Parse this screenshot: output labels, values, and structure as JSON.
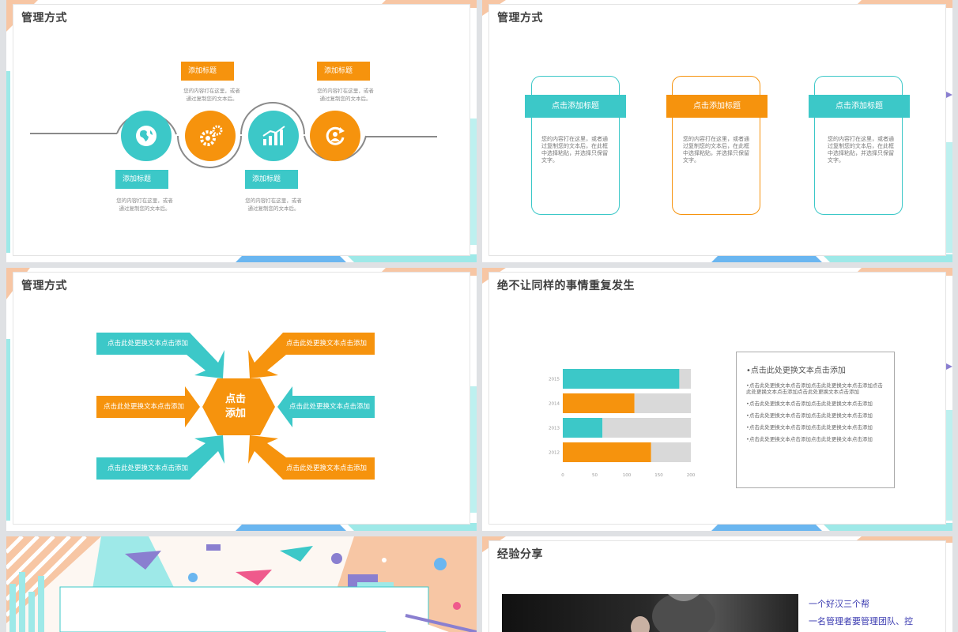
{
  "slides": {
    "s1": {
      "title": "管理方式",
      "tags": [
        {
          "label": "添加标题",
          "text_line1": "您的内容打在这里，或者",
          "text_line2": "通过复制您的文本后。"
        },
        {
          "label": "添加标题",
          "text_line1": "您的内容打在这里，或者",
          "text_line2": "通过复制您的文本后。"
        },
        {
          "label": "添加标题",
          "text_line1": "您的内容打在这里，或者",
          "text_line2": "通过复制您的文本后。"
        },
        {
          "label": "添加标题",
          "text_line1": "您的内容打在这里，或者",
          "text_line2": "通过复制您的文本后。"
        }
      ],
      "icons": [
        "globe-icon",
        "gears-icon",
        "bar-chart-icon",
        "refresh-person-icon"
      ]
    },
    "s2": {
      "title": "管理方式",
      "cards": [
        {
          "head": "点击添加标题",
          "text": "您的内容打在这里，或者通过复制您的文本后，在此框中选择粘贴，并选择只保留文字。",
          "color": "#3cc8c8"
        },
        {
          "head": "点击添加标题",
          "text": "您的内容打在这里，或者通过复制您的文本后，在此框中选择粘贴，并选择只保留文字。",
          "color": "#f6930d"
        },
        {
          "head": "点击添加标题",
          "text": "您的内容打在这里，或者通过复制您的文本后，在此框中选择粘贴，并选择只保留文字。",
          "color": "#3cc8c8"
        }
      ]
    },
    "s3": {
      "title": "管理方式",
      "center_line1": "点击",
      "center_line2": "添加",
      "arrows": [
        {
          "label": "点击此处更换文本点击添加",
          "color": "#3cc8c8"
        },
        {
          "label": "点击此处更换文本点击添加",
          "color": "#f6930d"
        },
        {
          "label": "点击此处更换文本点击添加",
          "color": "#f6930d"
        },
        {
          "label": "点击此处更换文本点击添加",
          "color": "#3cc8c8"
        },
        {
          "label": "点击此处更换文本点击添加",
          "color": "#3cc8c8"
        },
        {
          "label": "点击此处更换文本点击添加",
          "color": "#f6930d"
        }
      ]
    },
    "s4": {
      "title": "绝不让同样的事情重复发生",
      "panel_heading": "•点击此处更换文本点击添加",
      "bullets": [
        "•点击此处更换文本点击添加点击此处更换文本点击添加点击此处更换文本点击添加点击此处更换文本点击添加",
        "•点击此处更换文本点击添加点击此处更换文本点击添加",
        "•点击此处更换文本点击添加点击此处更换文本点击添加",
        "•点击此处更换文本点击添加点击此处更换文本点击添加",
        "•点击此处更换文本点击添加点击此处更换文本点击添加"
      ]
    },
    "s6": {
      "title": "经验分享",
      "line1": "一个好汉三个帮",
      "line2": "一名管理者要管理团队、控"
    }
  },
  "chart_data": {
    "type": "bar",
    "orientation": "horizontal",
    "stacked": true,
    "categories": [
      "2015",
      "2014",
      "2013",
      "2012"
    ],
    "series": [
      {
        "values": [
          182,
          112,
          62,
          138
        ],
        "color_per_bar": [
          "#3cc8c8",
          "#f6930d",
          "#3cc8c8",
          "#f6930d"
        ]
      },
      {
        "values": [
          18,
          88,
          138,
          62
        ],
        "color": "#d9d9d9"
      }
    ],
    "xticks": [
      "0",
      "50",
      "100",
      "150",
      "200"
    ],
    "xlim": [
      0,
      200
    ]
  },
  "colors": {
    "teal": "#3cc8c8",
    "orange": "#f6930d",
    "light_teal": "#9ee9e8",
    "peach": "#f7c6a4",
    "purple": "#8a7fd0",
    "blue": "#6ab6f0"
  }
}
